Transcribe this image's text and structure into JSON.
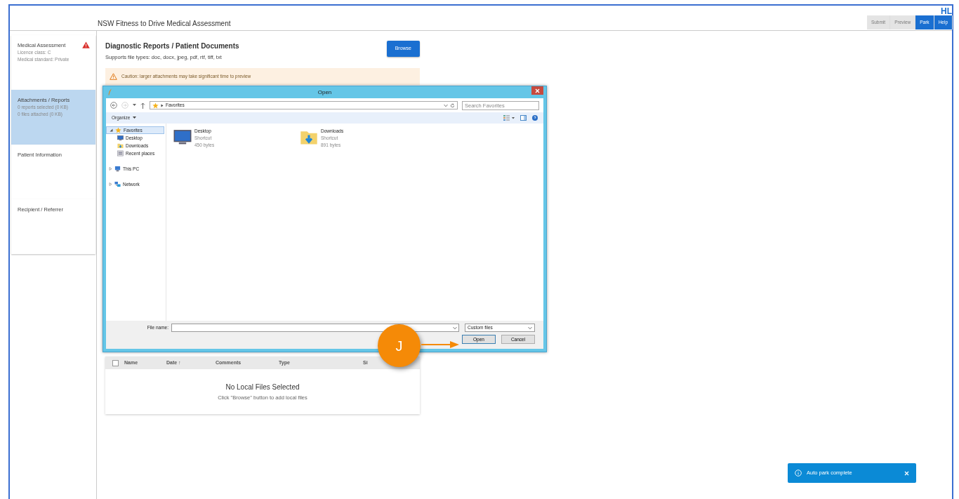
{
  "header": {
    "logo": "HL",
    "title": "NSW Fitness to Drive Medical Assessment",
    "buttons": [
      {
        "label": "Submit",
        "disabled": true
      },
      {
        "label": "Preview",
        "disabled": true
      },
      {
        "label": "Park",
        "disabled": false
      },
      {
        "label": "Help",
        "disabled": false
      }
    ]
  },
  "sidebar": {
    "items": [
      {
        "title": "Medical Assessment",
        "lines": [
          "Licence class: C",
          "Medical standard: Private"
        ],
        "selected": false,
        "warning": true
      },
      {
        "title": "Attachments / Reports",
        "lines": [
          "0 reports selected (0 KB)",
          "0 files attached (0 KB)"
        ],
        "selected": true,
        "warning": false
      },
      {
        "title": "Patient Information",
        "selected": false,
        "warning": false
      },
      {
        "title": "Recipient / Referrer",
        "selected": false,
        "warning": false
      }
    ]
  },
  "main": {
    "heading": "Diagnostic Reports / Patient Documents",
    "subheading": "Supports file types: doc, docx, jpeg, pdf, rtf, tiff, txt",
    "browse_button": "Browse",
    "caution": "Caution: larger attachments may take significant time to preview",
    "table": {
      "select_all_checked": false,
      "columns": [
        "Name",
        "Date ↑",
        "Comments",
        "Type",
        "Si"
      ],
      "empty_title": "No Local Files Selected",
      "empty_hint": "Click \"Browse\" button to add local files"
    }
  },
  "dialog": {
    "title": "Open",
    "path": "Favorites",
    "search_placeholder": "Search Favorites",
    "organize": "Organize",
    "tree": [
      {
        "label": "Favorites",
        "kind": "star",
        "expanded": true,
        "selected": true,
        "children": [
          {
            "label": "Desktop",
            "kind": "monitor",
            "selected": false
          },
          {
            "label": "Downloads",
            "kind": "folder",
            "selected": false
          },
          {
            "label": "Recent places",
            "kind": "places",
            "selected": false
          }
        ]
      },
      {
        "label": "This PC",
        "kind": "computer",
        "expanded": false,
        "selected": false
      },
      {
        "label": "Network",
        "kind": "network",
        "expanded": false,
        "selected": false
      }
    ],
    "files": [
      {
        "name": "Desktop",
        "type": "Shortcut",
        "size": "450 bytes",
        "kind": "monitor"
      },
      {
        "name": "Downloads",
        "type": "Shortcut",
        "size": "891 bytes",
        "kind": "folder"
      }
    ],
    "file_name_label": "File name:",
    "file_type": "Custom files",
    "buttons": [
      "Open",
      "Cancel"
    ]
  },
  "annotation": {
    "letter": "J"
  },
  "toast": {
    "text": "Auto park complete"
  }
}
